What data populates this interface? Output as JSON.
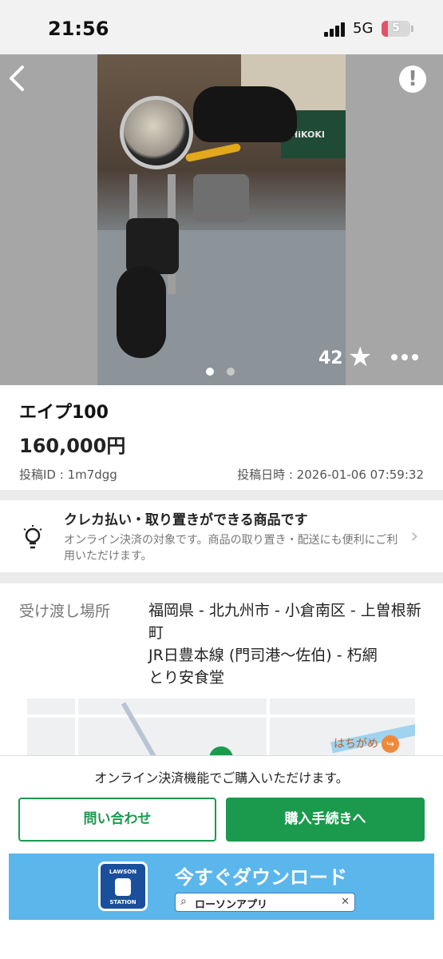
{
  "status_bar": {
    "time": "21:56",
    "network": "5G",
    "battery": "5"
  },
  "gallery": {
    "favorite_count": "42"
  },
  "listing": {
    "title": "エイプ100",
    "price": "160,000円",
    "post_id": "投稿ID : 1m7dgg",
    "post_date": "投稿日時 : 2026-01-06 07:59:32"
  },
  "notice": {
    "title": "クレカ払い・取り置きができる商品です",
    "body": "オンライン決済の対象です。商品の取り置き・配送にも便利にご利用いただけます。"
  },
  "location": {
    "label": "受け渡し場所",
    "value": "福岡県 - 北九州市 - 小倉南区 - 上曽根新町\nJR日豊本線 (門司港〜佐伯) - 朽網\nとり安食堂"
  },
  "map": {
    "poi_label": "はちがめ"
  },
  "purchase": {
    "message": "オンライン決済機能でご購入いただけます。",
    "inquiry_label": "問い合わせ",
    "purchase_label": "購入手続きへ"
  },
  "ad": {
    "logo_top": "LAWSON",
    "logo_bottom": "STATION",
    "headline": "今すぐダウンロード",
    "search_text": "ローソンアプリ",
    "brand_color": "#1a4f9c"
  },
  "photo": {
    "box_label": "HiKOKI"
  },
  "colors": {
    "accent": "#1b9a4d",
    "battery_low": "#e0536c"
  }
}
